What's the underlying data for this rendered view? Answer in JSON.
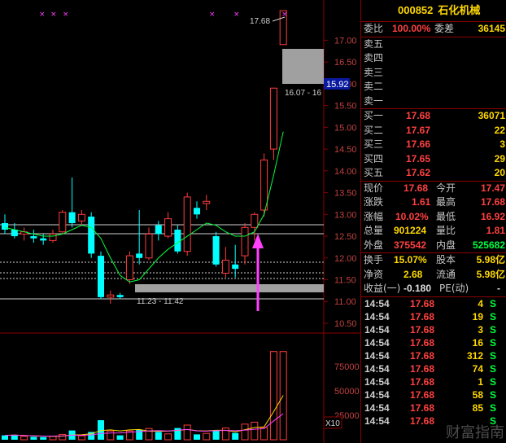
{
  "stock": {
    "code": "000852",
    "name": "石化机械"
  },
  "order_book": {
    "weibi_label": "委比",
    "weibi_value": "100.00%",
    "weicha_label": "委差",
    "weicha_value": "36145",
    "asks": [
      {
        "label": "卖五",
        "price": "",
        "vol": ""
      },
      {
        "label": "卖四",
        "price": "",
        "vol": ""
      },
      {
        "label": "卖三",
        "price": "",
        "vol": ""
      },
      {
        "label": "卖二",
        "price": "",
        "vol": ""
      },
      {
        "label": "卖一",
        "price": "",
        "vol": ""
      }
    ],
    "bids": [
      {
        "label": "买一",
        "price": "17.68",
        "vol": "36071"
      },
      {
        "label": "买二",
        "price": "17.67",
        "vol": "22"
      },
      {
        "label": "买三",
        "price": "17.66",
        "vol": "3"
      },
      {
        "label": "买四",
        "price": "17.65",
        "vol": "29"
      },
      {
        "label": "买五",
        "price": "17.62",
        "vol": "20"
      }
    ]
  },
  "quote": {
    "rows": [
      {
        "l1": "现价",
        "v1": "17.68",
        "l2": "今开",
        "v2": "17.47"
      },
      {
        "l1": "涨跌",
        "v1": "1.61",
        "l2": "最高",
        "v2": "17.68"
      },
      {
        "l1": "涨幅",
        "v1": "10.02%",
        "l2": "最低",
        "v2": "16.92"
      },
      {
        "l1": "总量",
        "v1": "901224",
        "l2": "量比",
        "v2": "1.81"
      },
      {
        "l1": "外盘",
        "v1": "375542",
        "l2": "内盘",
        "v2": "525682"
      },
      {
        "l1": "换手",
        "v1": "15.07%",
        "l2": "股本",
        "v2": "5.98亿"
      },
      {
        "l1": "净资",
        "v1": "2.68",
        "l2": "流通",
        "v2": "5.98亿"
      },
      {
        "l1": "收益(一)",
        "v1": "-0.180",
        "l2": "PE(动)",
        "v2": "-"
      }
    ]
  },
  "ticks": [
    {
      "time": "14:54",
      "price": "17.68",
      "vol": "4",
      "side": "S"
    },
    {
      "time": "14:54",
      "price": "17.68",
      "vol": "19",
      "side": "S"
    },
    {
      "time": "14:54",
      "price": "17.68",
      "vol": "3",
      "side": "S"
    },
    {
      "time": "14:54",
      "price": "17.68",
      "vol": "16",
      "side": "S"
    },
    {
      "time": "14:54",
      "price": "17.68",
      "vol": "312",
      "side": "S"
    },
    {
      "time": "14:54",
      "price": "17.68",
      "vol": "74",
      "side": "S"
    },
    {
      "time": "14:54",
      "price": "17.68",
      "vol": "1",
      "side": "S"
    },
    {
      "time": "14:54",
      "price": "17.68",
      "vol": "58",
      "side": "S"
    },
    {
      "time": "14:54",
      "price": "17.68",
      "vol": "85",
      "side": "S"
    },
    {
      "time": "14:54",
      "price": "17.68",
      "vol": "",
      "side": "S"
    }
  ],
  "chart_data": {
    "type": "candlestick",
    "price_axis": {
      "ticks": [
        "17.00",
        "16.50",
        "16.00",
        "15.50",
        "15.00",
        "14.50",
        "14.00",
        "13.50",
        "13.00",
        "12.50",
        "12.00",
        "11.50",
        "11.00",
        "10.50"
      ],
      "range": [
        10.35,
        17.55
      ]
    },
    "volume_axis": {
      "ticks": [
        "75000",
        "50000",
        "25000"
      ],
      "multiplier": "X10",
      "range": [
        0,
        100000
      ]
    },
    "annotations": {
      "high_label": "17.68",
      "current_price_label": "15.92",
      "gap_label": "16.07 - 16",
      "low_range_label": "11.23 - 11.42"
    },
    "candles": [
      {
        "o": 12.8,
        "h": 13.0,
        "l": 12.55,
        "c": 12.65,
        "v": 4500
      },
      {
        "o": 12.65,
        "h": 12.8,
        "l": 12.45,
        "c": 12.5,
        "v": 5000
      },
      {
        "o": 12.55,
        "h": 12.7,
        "l": 12.4,
        "c": 12.6,
        "v": 3500
      },
      {
        "o": 12.5,
        "h": 12.65,
        "l": 12.35,
        "c": 12.45,
        "v": 3000
      },
      {
        "o": 12.45,
        "h": 12.55,
        "l": 12.3,
        "c": 12.4,
        "v": 2800
      },
      {
        "o": 12.4,
        "h": 12.65,
        "l": 12.35,
        "c": 12.55,
        "v": 3500
      },
      {
        "o": 12.6,
        "h": 13.1,
        "l": 12.55,
        "c": 13.05,
        "v": 5500
      },
      {
        "o": 13.05,
        "h": 13.85,
        "l": 12.7,
        "c": 12.8,
        "v": 9500
      },
      {
        "o": 12.85,
        "h": 13.1,
        "l": 12.75,
        "c": 13.0,
        "v": 4000
      },
      {
        "o": 12.95,
        "h": 13.05,
        "l": 12.0,
        "c": 12.1,
        "v": 8000
      },
      {
        "o": 12.05,
        "h": 12.15,
        "l": 11.05,
        "c": 11.1,
        "v": 20000
      },
      {
        "o": 11.1,
        "h": 11.25,
        "l": 10.95,
        "c": 11.15,
        "v": 9000
      },
      {
        "o": 11.15,
        "h": 11.2,
        "l": 11.05,
        "c": 11.1,
        "v": 4500
      },
      {
        "o": 11.5,
        "h": 12.15,
        "l": 11.4,
        "c": 12.05,
        "v": 9000
      },
      {
        "o": 12.1,
        "h": 13.1,
        "l": 11.85,
        "c": 12.0,
        "v": 10000
      },
      {
        "o": 12.0,
        "h": 12.7,
        "l": 11.95,
        "c": 12.55,
        "v": 11500
      },
      {
        "o": 12.75,
        "h": 12.85,
        "l": 12.4,
        "c": 12.55,
        "v": 8000
      },
      {
        "o": 12.5,
        "h": 13.05,
        "l": 12.45,
        "c": 12.9,
        "v": 6000
      },
      {
        "o": 12.65,
        "h": 12.75,
        "l": 12.1,
        "c": 12.15,
        "v": 12000
      },
      {
        "o": 12.15,
        "h": 13.5,
        "l": 12.05,
        "c": 13.4,
        "v": 15000
      },
      {
        "o": 13.15,
        "h": 13.3,
        "l": 12.9,
        "c": 13.0,
        "v": 5500
      },
      {
        "o": 13.25,
        "h": 13.45,
        "l": 13.1,
        "c": 13.3,
        "v": 6500
      },
      {
        "o": 12.5,
        "h": 12.6,
        "l": 11.8,
        "c": 11.85,
        "v": 9500
      },
      {
        "o": 11.65,
        "h": 12.25,
        "l": 11.55,
        "c": 11.95,
        "v": 12000
      },
      {
        "o": 11.85,
        "h": 12.3,
        "l": 11.55,
        "c": 11.75,
        "v": 7000
      },
      {
        "o": 12.05,
        "h": 12.8,
        "l": 11.85,
        "c": 12.7,
        "v": 16000
      },
      {
        "o": 12.7,
        "h": 13.05,
        "l": 12.4,
        "c": 13.0,
        "v": 18000
      },
      {
        "o": 13.1,
        "h": 14.4,
        "l": 12.95,
        "c": 14.25,
        "v": 12500
      },
      {
        "o": 14.5,
        "h": 15.9,
        "l": 14.25,
        "c": 15.9,
        "v": 90224
      },
      {
        "o": 16.9,
        "h": 17.68,
        "l": 16.92,
        "c": 17.68,
        "v": 90224
      }
    ],
    "ma_line": [
      12.7,
      12.65,
      12.6,
      12.55,
      12.5,
      12.5,
      12.55,
      12.65,
      12.75,
      12.7,
      12.45,
      12.0,
      11.6,
      11.45,
      11.5,
      11.75,
      12.0,
      12.2,
      12.35,
      12.5,
      12.65,
      12.8,
      12.75,
      12.6,
      12.5,
      12.5,
      12.6,
      13.0,
      13.9,
      14.9
    ]
  }
}
